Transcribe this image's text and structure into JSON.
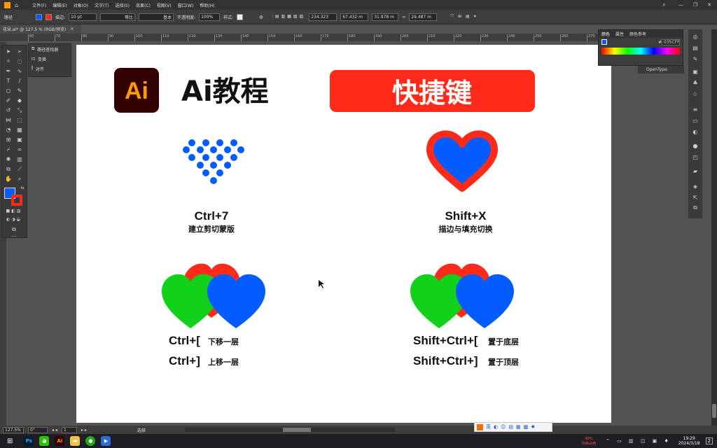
{
  "menubar": {
    "items": [
      "文件(F)",
      "编辑(E)",
      "对象(O)",
      "文字(T)",
      "选择(S)",
      "效果(C)",
      "视图(V)",
      "窗口(W)",
      "帮助(H)"
    ]
  },
  "control": {
    "label_path": "路径",
    "stroke_label": "描边:",
    "stroke_value": "10 pt",
    "stroke_style": "等比",
    "brush": "基本",
    "opacity_label": "不透明度:",
    "opacity_value": "100%",
    "style_label": "样式:",
    "x_value": "234.323",
    "y_value": "67.432 m",
    "w_value": "31.978 m",
    "h_value": "29.487 m"
  },
  "doc_tab": {
    "title": "花朵.ai* @ 127.5 % (RGB/预览)",
    "close": "×"
  },
  "ruler_ticks": [
    "60",
    "70",
    "80",
    "90",
    "100",
    "110",
    "120",
    "130",
    "140",
    "150",
    "160",
    "170",
    "180",
    "190",
    "200",
    "210",
    "220",
    "230",
    "240",
    "250",
    "260",
    "270",
    "280",
    "290"
  ],
  "flyout": {
    "items": [
      "路径查找器",
      "变换",
      "对齐"
    ]
  },
  "color_panel": {
    "tabs": [
      "颜色",
      "属性",
      "颜色参考"
    ],
    "hex": "035CFF",
    "hex_prefix": "#",
    "fill_color": "#035CFF",
    "opentype": "OpenType"
  },
  "artboard": {
    "logo_text": "Ai",
    "title": "Ai教程",
    "banner": "快捷键",
    "items": [
      {
        "key": "Ctrl+7",
        "desc": "建立剪切蒙版"
      },
      {
        "key": "Shift+X",
        "desc": "描边与填充切换"
      },
      {
        "key1": "Ctrl+[",
        "desc1": "下移一层",
        "key2": "Ctrl+]",
        "desc2": "上移一层"
      },
      {
        "key1": "Shift+Ctrl+[",
        "desc1": "置于底层",
        "key2": "Shift+Ctrl+]",
        "desc2": "置于顶层"
      }
    ],
    "colors": {
      "red": "#FF2A1A",
      "blue": "#035CFF",
      "green": "#12D11A",
      "orange": "#FF9A00",
      "logo_bg": "#330000"
    }
  },
  "status": {
    "zoom": "127.5%",
    "rotate": "0°",
    "page": "1",
    "mode": "选择"
  },
  "ime": {
    "label": "英"
  },
  "taskbar": {
    "mem_pct": "90%",
    "mem_label": "内存占用",
    "time": "19:29",
    "date": "2024/3/18",
    "notif": "2"
  }
}
